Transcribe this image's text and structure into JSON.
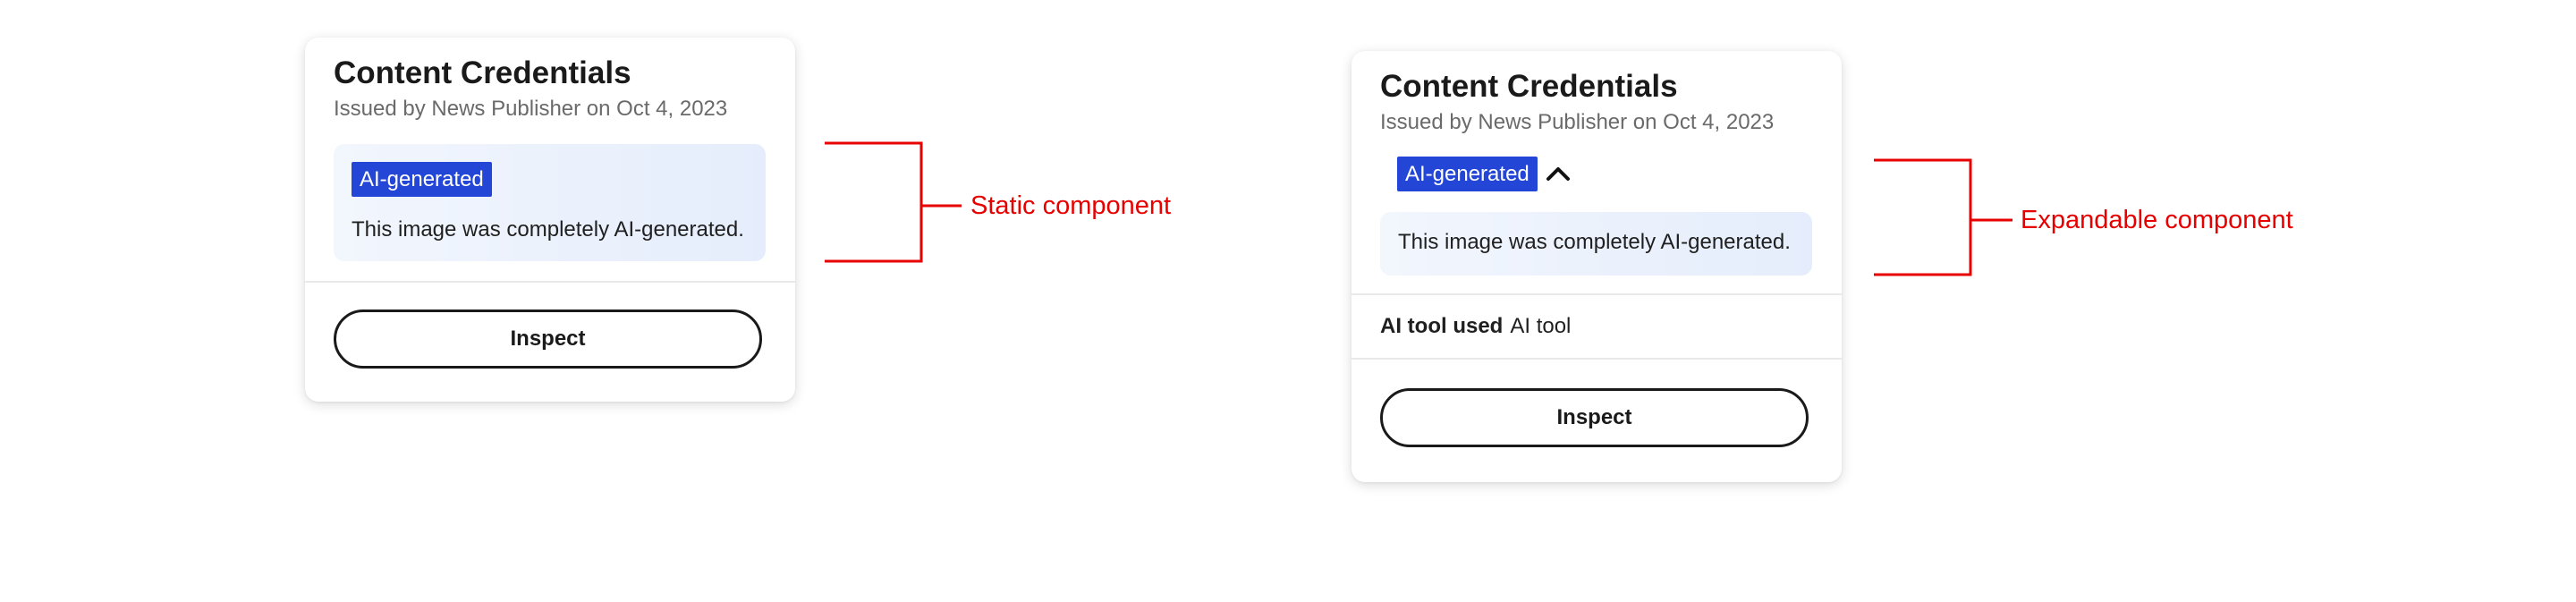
{
  "cards": {
    "static": {
      "title": "Content Credentials",
      "subtitle": "Issued by News Publisher on Oct 4, 2023",
      "badge": "AI-generated",
      "description": "This image was completely AI-generated.",
      "button": "Inspect"
    },
    "expandable": {
      "title": "Content Credentials",
      "subtitle": "Issued by News Publisher on Oct 4, 2023",
      "badge": "AI-generated",
      "description": "This image was completely AI-generated.",
      "tool_label": "AI tool used",
      "tool_value": "AI tool",
      "button": "Inspect",
      "expanded": true
    }
  },
  "annotations": {
    "static": "Static component",
    "expandable": "Expandable component"
  },
  "colors": {
    "badge": "#2346d6",
    "annotation": "#e60000",
    "info_box_start": "#f2f6fd",
    "info_box_end": "#e5edfc"
  },
  "icons": {
    "expand_toggle": "chevron-up-icon"
  }
}
